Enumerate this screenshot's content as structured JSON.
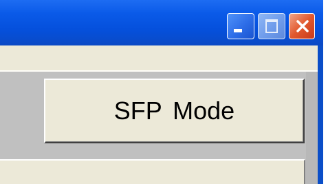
{
  "window": {
    "controls": {
      "minimize_icon": "minimize-icon",
      "maximize_icon": "maximize-icon",
      "close_icon": "close-icon"
    },
    "colors": {
      "titlebar": "#0550dc",
      "face": "#ece9d8",
      "close": "#e2592e"
    }
  },
  "main": {
    "sfp_button_label": "SFP Mode"
  }
}
